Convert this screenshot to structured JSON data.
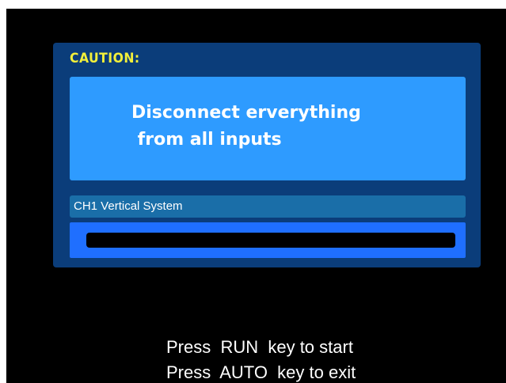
{
  "dialog": {
    "title": "CAUTION:",
    "message_line1": "Disconnect erverything",
    "message_line2": " from all inputs",
    "progress_label": "CH1 Vertical System",
    "progress_fraction": 0
  },
  "footer": {
    "line1": "Press  RUN  key to start",
    "line2": "Press  AUTO  key to exit"
  },
  "colors": {
    "dialog_bg": "#0b3d7a",
    "caution_text": "#f2ef3a",
    "message_bg": "#2e9bff",
    "progress_label_bg": "#1a6ea8",
    "progress_frame_bg": "#1f6fff",
    "screen_bg": "#000000"
  }
}
